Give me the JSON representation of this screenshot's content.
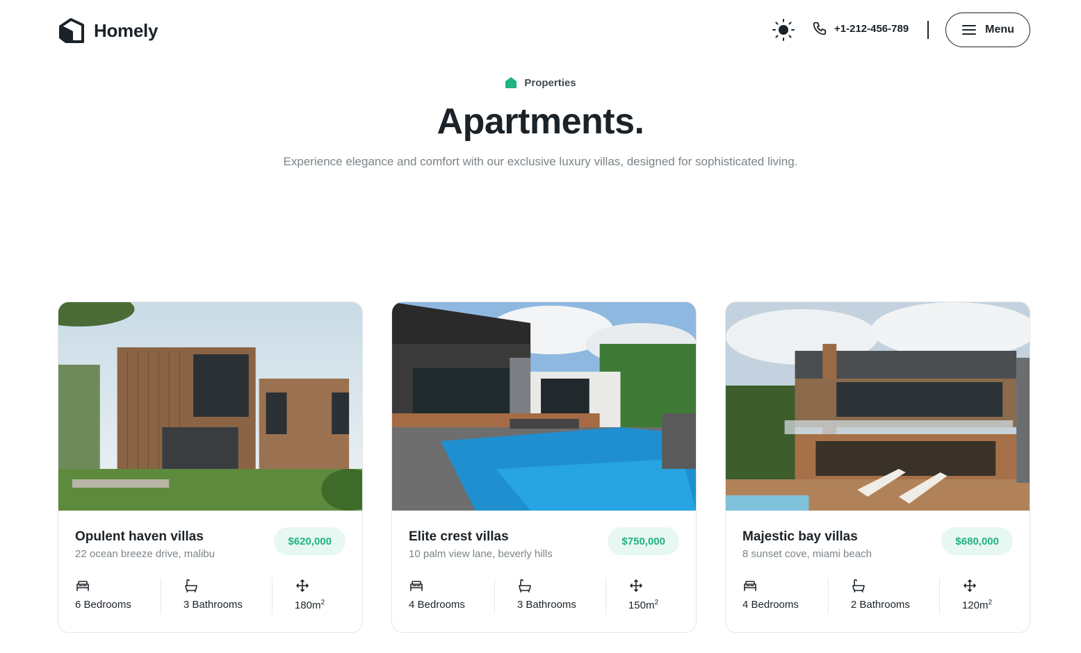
{
  "header": {
    "brand": "Homely",
    "phone": "+1-212-456-789",
    "menu_label": "Menu"
  },
  "hero": {
    "eyebrow": "Properties",
    "title": "Apartments.",
    "subtitle": "Experience elegance and comfort with our exclusive luxury villas, designed for sophisticated living."
  },
  "colors": {
    "accent": "#20b27f",
    "accent_bg": "#e7f7f1",
    "text": "#1b2228",
    "muted": "#7b8388"
  },
  "cards": [
    {
      "title": "Opulent haven villas",
      "address": "22 ocean breeze drive, malibu",
      "price": "$620,000",
      "bedrooms": "6 Bedrooms",
      "bathrooms": "3 Bathrooms",
      "area": "180m",
      "area_sup": "2"
    },
    {
      "title": "Elite crest villas",
      "address": "10 palm view lane, beverly hills",
      "price": "$750,000",
      "bedrooms": "4 Bedrooms",
      "bathrooms": "3 Bathrooms",
      "area": "150m",
      "area_sup": "2"
    },
    {
      "title": "Majestic bay villas",
      "address": "8 sunset cove, miami beach",
      "price": "$680,000",
      "bedrooms": "4 Bedrooms",
      "bathrooms": "2 Bathrooms",
      "area": "120m",
      "area_sup": "2"
    }
  ],
  "icons": {
    "logo": "house-logo-icon",
    "theme": "sun-icon",
    "phone": "phone-icon",
    "menu": "hamburger-icon",
    "eyebrow": "home-icon",
    "bed": "bed-icon",
    "bath": "bathtub-icon",
    "area": "move-arrows-icon"
  }
}
